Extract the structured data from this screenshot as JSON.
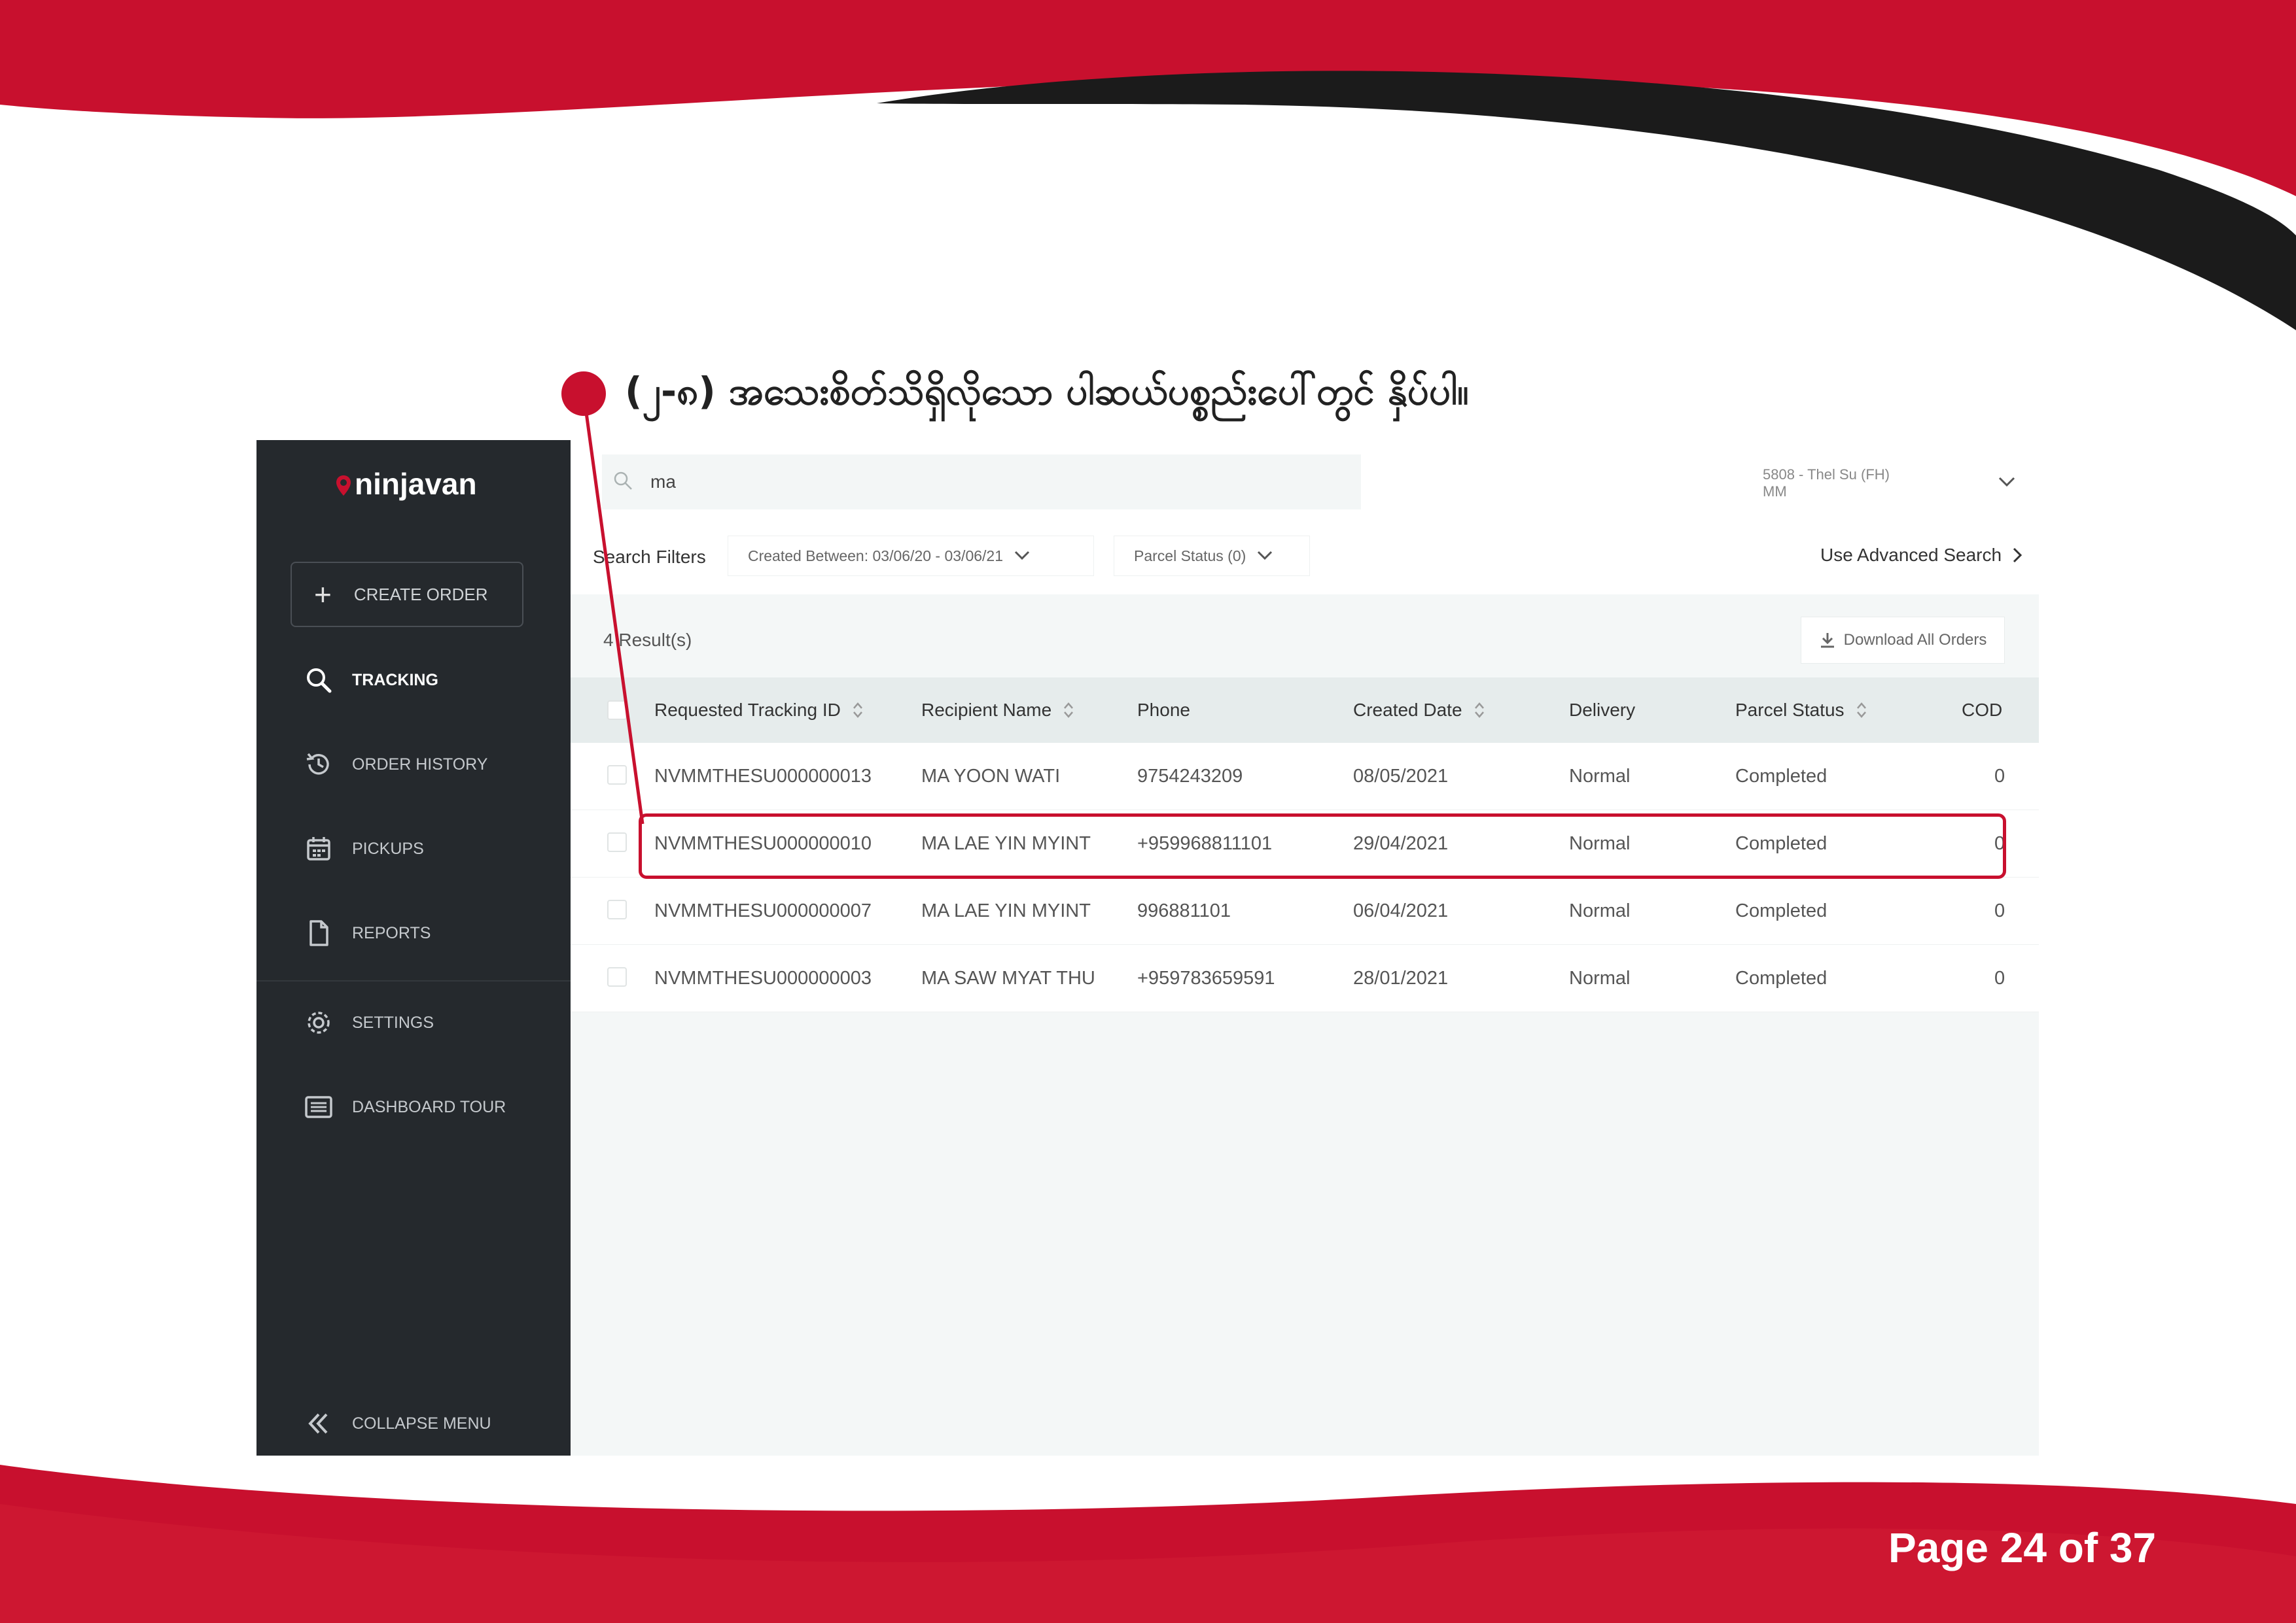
{
  "instruction": "(၂-၈) အသေးစိတ်သိရှိလိုသော ပါဆယ်ပစ္စည်းပေါ်တွင် နှိပ်ပါ။",
  "brand": {
    "logo_text": "ninjavan",
    "accent": "#c8102e"
  },
  "sidebar": {
    "create_order": "CREATE ORDER",
    "items": [
      {
        "label": "TRACKING",
        "icon": "search-icon",
        "active": true
      },
      {
        "label": "ORDER HISTORY",
        "icon": "history-icon"
      },
      {
        "label": "PICKUPS",
        "icon": "calendar-icon"
      },
      {
        "label": "REPORTS",
        "icon": "document-icon"
      },
      {
        "label": "SETTINGS",
        "icon": "gear-icon"
      },
      {
        "label": "DASHBOARD TOUR",
        "icon": "list-icon"
      }
    ],
    "collapse": "COLLAPSE MENU"
  },
  "search": {
    "value": "ma"
  },
  "account": {
    "line1": "5808 - Thel Su (FH)",
    "line2": "MM"
  },
  "filters": {
    "label": "Search Filters",
    "created_between": "Created Between: 03/06/20 - 03/06/21",
    "parcel_status": "Parcel Status (0)",
    "advanced": "Use Advanced Search"
  },
  "results": {
    "count_text": "4 Result(s)",
    "download": "Download All Orders"
  },
  "table": {
    "headers": [
      "Requested Tracking ID",
      "Recipient Name",
      "Phone",
      "Created Date",
      "Delivery",
      "Parcel Status",
      "COD"
    ],
    "rows": [
      [
        "NVMMTHESU000000013",
        "MA YOON WATI",
        "9754243209",
        "08/05/2021",
        "Normal",
        "Completed",
        "0"
      ],
      [
        "NVMMTHESU000000010",
        "MA LAE YIN MYINT",
        "+959968811101",
        "29/04/2021",
        "Normal",
        "Completed",
        "0"
      ],
      [
        "NVMMTHESU000000007",
        "MA LAE YIN MYINT",
        "996881101",
        "06/04/2021",
        "Normal",
        "Completed",
        "0"
      ],
      [
        "NVMMTHESU000000003",
        "MA SAW MYAT THU",
        "+959783659591",
        "28/01/2021",
        "Normal",
        "Completed",
        "0"
      ]
    ]
  },
  "page": "Page 24 of 37"
}
